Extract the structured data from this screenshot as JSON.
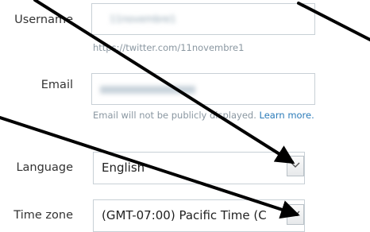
{
  "username": {
    "label": "Username",
    "value": "11novembre1",
    "profile_url": "https://twitter.com/11novembre1"
  },
  "email": {
    "label": "Email",
    "value": "",
    "hint": "Email will not be publicly displayed.",
    "learn_more": "Learn more."
  },
  "language": {
    "label": "Language",
    "selected": "English"
  },
  "timezone": {
    "label": "Time zone",
    "selected": "(GMT-07:00) Pacific Time (C"
  },
  "colors": {
    "link": "#2b7bb9",
    "hint": "#8a97a1",
    "border": "#c8d0d6"
  }
}
